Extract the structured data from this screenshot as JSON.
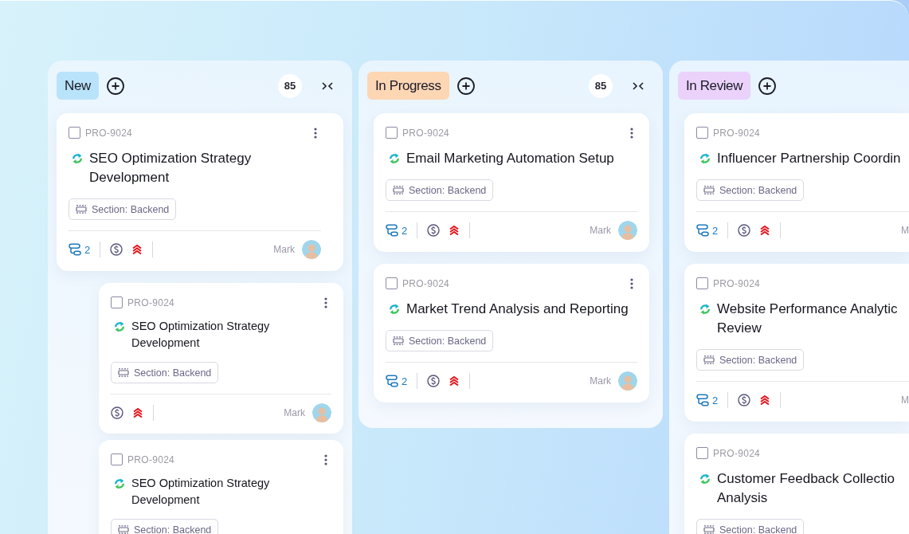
{
  "columns": [
    {
      "title": "New",
      "color": "#b9e3fa",
      "count": "85",
      "cards": [
        {
          "id": "PRO-9024",
          "checked": false,
          "title": "SEO Optimization Strategy Development",
          "section": "Section: Backend",
          "subtasks": "2",
          "assignee": "Mark",
          "children": [
            {
              "id": "PRO-9024",
              "checked": false,
              "title": "SEO Optimization Strategy Development",
              "section": "Section: Backend",
              "assignee": "Mark"
            },
            {
              "id": "PRO-9024",
              "checked": false,
              "title": "SEO Optimization Strategy Development",
              "section": "Section: Backend"
            }
          ]
        }
      ]
    },
    {
      "title": "In Progress",
      "color": "#fdd6b4",
      "count": "85",
      "cards": [
        {
          "id": "PRO-9024",
          "checked": false,
          "title": "Email Marketing Automation Setup",
          "section": "Section: Backend",
          "subtasks": "2",
          "assignee": "Mark"
        },
        {
          "id": "PRO-9024",
          "checked": false,
          "title": "Market Trend Analysis and Reporting",
          "section": "Section: Backend",
          "subtasks": "2",
          "assignee": "Mark"
        }
      ]
    },
    {
      "title": "In Review",
      "color": "#ebd2fb",
      "cards": [
        {
          "id": "PRO-9024",
          "checked": false,
          "title": "Influencer Partnership Coordin",
          "section": "Section: Backend",
          "subtasks": "2",
          "assignee": "M"
        },
        {
          "id": "PRO-9024",
          "checked": false,
          "title": "Website Performance Analytic Review",
          "section": "Section: Backend",
          "subtasks": "2",
          "assignee": "M"
        },
        {
          "id": "PRO-9024",
          "checked": false,
          "title": "Customer Feedback Collectio Analysis",
          "section": "Section: Backend"
        }
      ]
    }
  ]
}
